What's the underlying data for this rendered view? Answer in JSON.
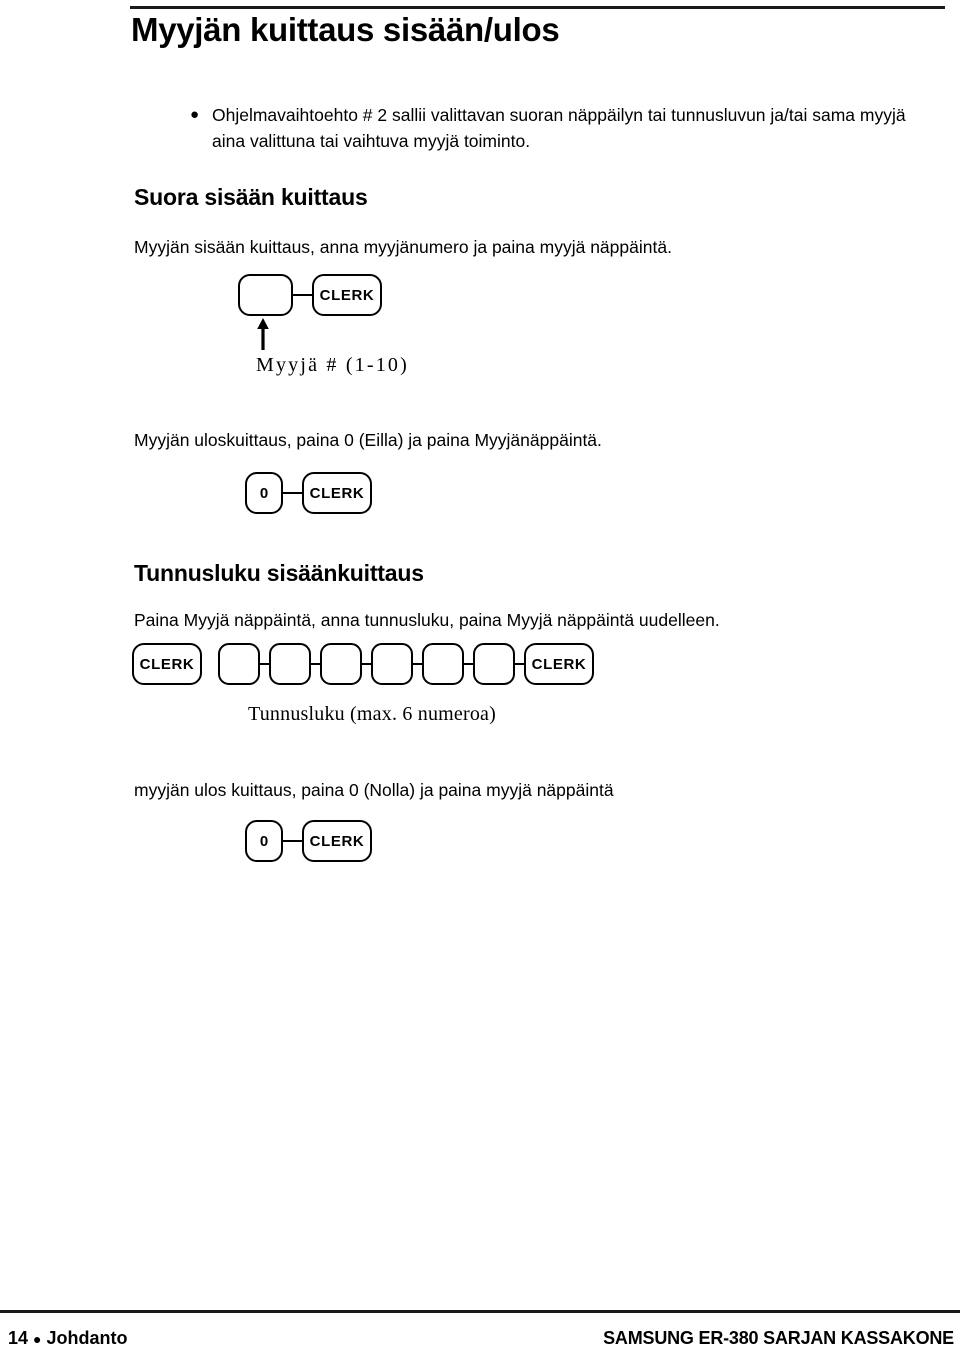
{
  "document": {
    "title": "Myyjän kuittaus sisään/ulos",
    "bullet": {
      "marker": "●",
      "text": "Ohjelmavaihtoehto # 2  sallii  valittavan suoran näppäilyn tai tunnusluvun ja/tai sama myyjä aina valittuna tai vaihtuva myyjä toiminto."
    },
    "sections": [
      {
        "heading": "Suora sisään kuittaus",
        "paragraph": "Myyjän sisään kuittaus, anna myyjänumero ja paina myyjä näppäintä.",
        "caption": "Myyjä # (1-10)"
      },
      {
        "paragraph": "Myyjän uloskuittaus, paina 0 (Eilla) ja paina Myyjänäppäintä."
      },
      {
        "heading": "Tunnusluku sisäänkuittaus",
        "paragraph": "Paina Myyjä  näppäintä, anna tunnusluku, paina Myyjä näppäintä uudelleen.",
        "caption": "Tunnusluku (max. 6 numeroa)"
      },
      {
        "paragraph": "myyjän ulos kuittaus, paina 0 (Nolla) ja paina myyjä näppäintä"
      }
    ],
    "keys": {
      "clerk_label": "CLERK",
      "zero_label": "0",
      "blank_label": "",
      "passcode_slot_count": 6
    },
    "footer": {
      "page_number": "14",
      "separator": "●",
      "chapter": "Johdanto",
      "product": "SAMSUNG ER-380 SARJAN KASSAKONE"
    }
  }
}
